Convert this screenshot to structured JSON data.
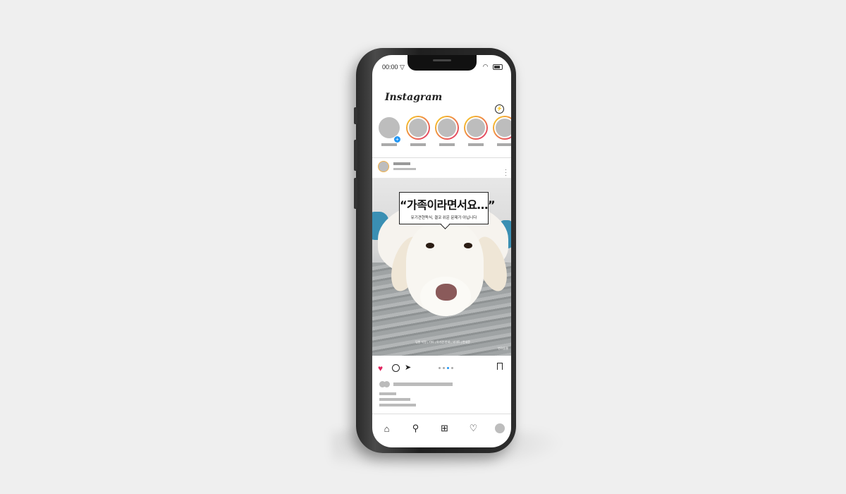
{
  "status_bar": {
    "time": "00:00 ▽",
    "wifi_icon": "wifi-icon",
    "battery_icon": "battery-icon"
  },
  "app": {
    "logo": "Instagram",
    "messenger_icon": "messenger-icon"
  },
  "stories": [
    {
      "own": true
    },
    {
      "own": false
    },
    {
      "own": false
    },
    {
      "own": false
    },
    {
      "own": false
    }
  ],
  "post": {
    "headline": "“가족이라면서요…”",
    "subline": "유기견현독식, 결코 쉬운 문제가 아닙니다",
    "footer_text": "입원 지원 | 기타 | 유기견 안내 | 사이트 | 안내문",
    "brand": "반려동물",
    "carousel": {
      "count": 4,
      "active_index": 2
    }
  },
  "actions": {
    "like_icon": "heart-icon",
    "comment_icon": "comment-icon",
    "share_icon": "send-icon",
    "save_icon": "bookmark-icon"
  },
  "tab_bar": {
    "home": "⌂",
    "search": "⚲",
    "add": "⊞",
    "activity": "♡"
  }
}
